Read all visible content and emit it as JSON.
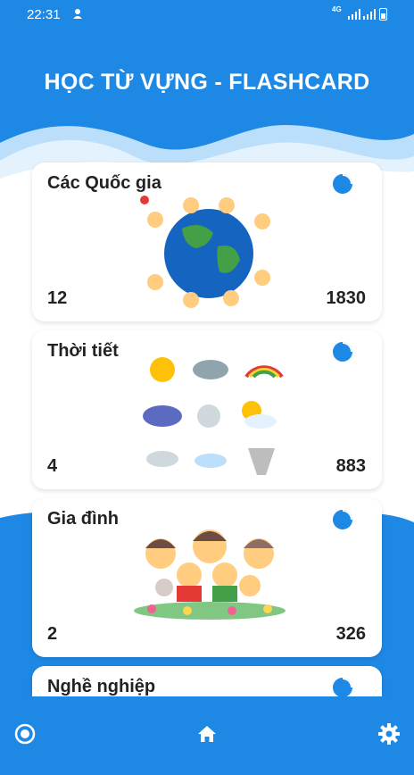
{
  "status_bar": {
    "time": "22:31",
    "network": "4G"
  },
  "header": {
    "title": "HỌC TỪ VỰNG - FLASHCARD"
  },
  "cards": [
    {
      "title": "Các Quốc gia",
      "left_count": "12",
      "right_count": "1830",
      "icon": "pie-chart-icon"
    },
    {
      "title": "Thời tiết",
      "left_count": "4",
      "right_count": "883",
      "icon": "pie-chart-icon"
    },
    {
      "title": "Gia đình",
      "left_count": "2",
      "right_count": "326",
      "icon": "pie-chart-icon"
    },
    {
      "title": "Nghề nghiệp",
      "icon": "pie-chart-icon"
    }
  ],
  "nav": {
    "left_icon": "radio-target-icon",
    "center_icon": "home-icon",
    "right_icon": "gear-icon"
  },
  "colors": {
    "primary": "#1e88e5",
    "wave_light": "#e3f2fd",
    "text": "#222222"
  }
}
